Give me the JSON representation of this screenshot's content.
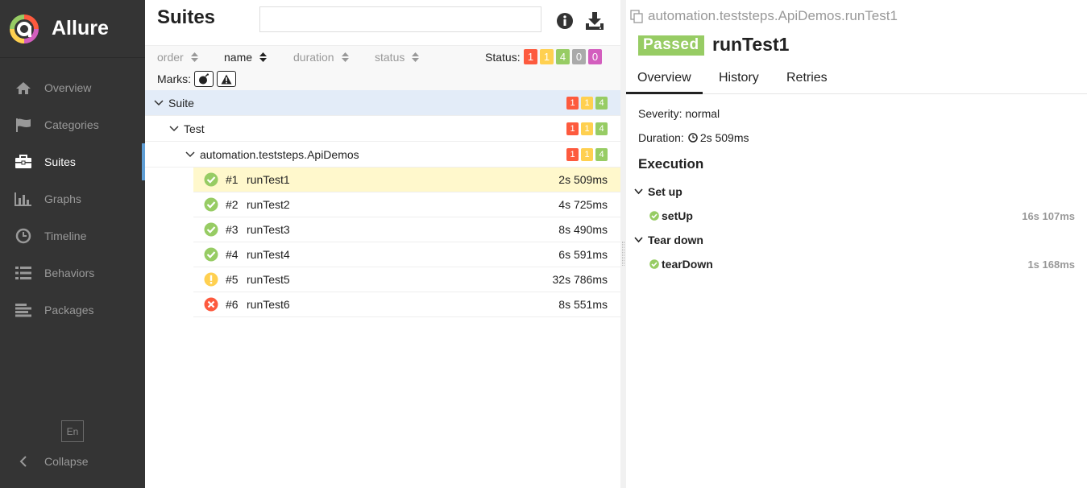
{
  "app": {
    "name": "Allure"
  },
  "sidebar": {
    "items": [
      {
        "label": "Overview"
      },
      {
        "label": "Categories"
      },
      {
        "label": "Suites"
      },
      {
        "label": "Graphs"
      },
      {
        "label": "Timeline"
      },
      {
        "label": "Behaviors"
      },
      {
        "label": "Packages"
      }
    ],
    "active": "Suites",
    "lang": "En",
    "collapse": "Collapse"
  },
  "suites": {
    "title": "Suites",
    "search_value": "",
    "sorters": [
      "order",
      "name",
      "duration",
      "status"
    ],
    "active_sorter": "name",
    "status_label": "Status:",
    "status_counts": [
      {
        "value": "1",
        "color": "#fd5a3e"
      },
      {
        "value": "1",
        "color": "#ffd050"
      },
      {
        "value": "4",
        "color": "#97cc64"
      },
      {
        "value": "0",
        "color": "#aaaaaa"
      },
      {
        "value": "0",
        "color": "#d35ebe"
      }
    ],
    "marks_label": "Marks:",
    "groups": [
      {
        "label": "Suite",
        "counts": [
          "1",
          "1",
          "4"
        ]
      },
      {
        "label": "Test",
        "counts": [
          "1",
          "1",
          "4"
        ]
      },
      {
        "label": "automation.teststeps.ApiDemos",
        "counts": [
          "1",
          "1",
          "4"
        ]
      }
    ],
    "tests": [
      {
        "num": "#1",
        "name": "runTest1",
        "duration": "2s 509ms",
        "status": "passed"
      },
      {
        "num": "#2",
        "name": "runTest2",
        "duration": "4s 725ms",
        "status": "passed"
      },
      {
        "num": "#3",
        "name": "runTest3",
        "duration": "8s 490ms",
        "status": "passed"
      },
      {
        "num": "#4",
        "name": "runTest4",
        "duration": "6s 591ms",
        "status": "passed"
      },
      {
        "num": "#5",
        "name": "runTest5",
        "duration": "32s 786ms",
        "status": "broken"
      },
      {
        "num": "#6",
        "name": "runTest6",
        "duration": "8s 551ms",
        "status": "failed"
      }
    ]
  },
  "detail": {
    "full_name": "automation.teststeps.ApiDemos.runTest1",
    "status": "Passed",
    "title": "runTest1",
    "tabs": [
      "Overview",
      "History",
      "Retries"
    ],
    "severity": "Severity: normal",
    "duration_label": "Duration:",
    "duration": "2s 509ms",
    "execution": "Execution",
    "setup_label": "Set up",
    "setup_step": {
      "name": "setUp",
      "duration": "16s 107ms"
    },
    "teardown_label": "Tear down",
    "teardown_step": {
      "name": "tearDown",
      "duration": "1s 168ms"
    }
  }
}
